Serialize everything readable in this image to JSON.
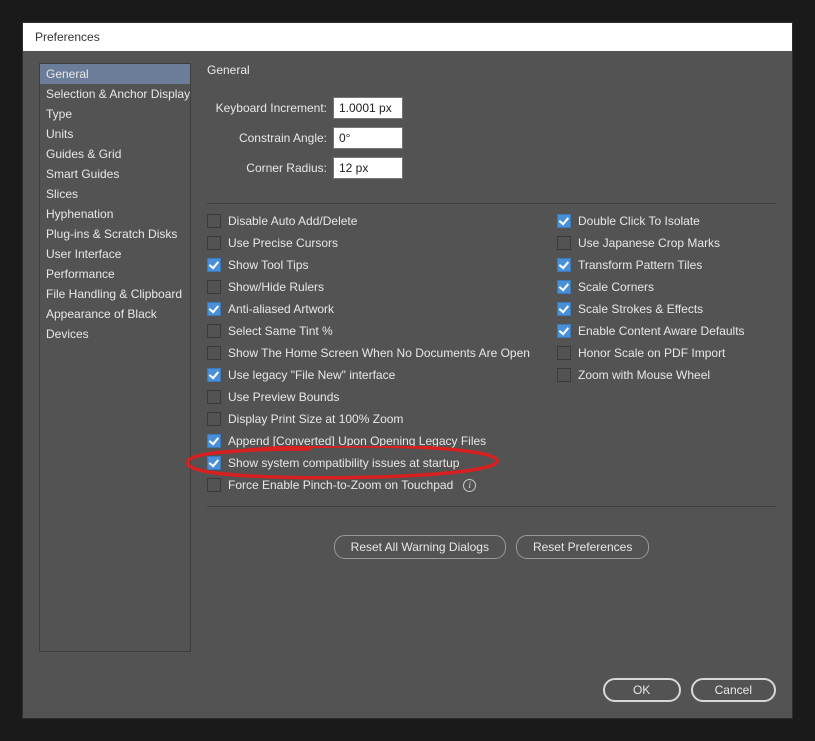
{
  "window": {
    "title": "Preferences"
  },
  "sidebar": {
    "items": [
      {
        "label": "General",
        "selected": true
      },
      {
        "label": "Selection & Anchor Display"
      },
      {
        "label": "Type"
      },
      {
        "label": "Units"
      },
      {
        "label": "Guides & Grid"
      },
      {
        "label": "Smart Guides"
      },
      {
        "label": "Slices"
      },
      {
        "label": "Hyphenation"
      },
      {
        "label": "Plug-ins & Scratch Disks"
      },
      {
        "label": "User Interface"
      },
      {
        "label": "Performance"
      },
      {
        "label": "File Handling & Clipboard"
      },
      {
        "label": "Appearance of Black"
      },
      {
        "label": "Devices"
      }
    ]
  },
  "panel": {
    "title": "General",
    "fields": {
      "keyboard_increment": {
        "label": "Keyboard Increment:",
        "value": "1.0001 px"
      },
      "constrain_angle": {
        "label": "Constrain Angle:",
        "value": "0°"
      },
      "corner_radius": {
        "label": "Corner Radius:",
        "value": "12 px"
      }
    },
    "checks_left": [
      {
        "label": "Disable Auto Add/Delete",
        "checked": false
      },
      {
        "label": "Use Precise Cursors",
        "checked": false
      },
      {
        "label": "Show Tool Tips",
        "checked": true
      },
      {
        "label": "Show/Hide Rulers",
        "checked": false
      },
      {
        "label": "Anti-aliased Artwork",
        "checked": true
      },
      {
        "label": "Select Same Tint %",
        "checked": false
      },
      {
        "label": "Show The Home Screen When No Documents Are Open",
        "checked": false
      },
      {
        "label": "Use legacy \"File New\" interface",
        "checked": true
      },
      {
        "label": "Use Preview Bounds",
        "checked": false
      },
      {
        "label": "Display Print Size at 100% Zoom",
        "checked": false
      },
      {
        "label": "Append [Converted] Upon Opening Legacy Files",
        "checked": true
      },
      {
        "label": "Show system compatibility issues at startup",
        "checked": true
      },
      {
        "label": "Force Enable Pinch-to-Zoom on Touchpad",
        "checked": false,
        "info": true
      }
    ],
    "checks_right": [
      {
        "label": "Double Click To Isolate",
        "checked": true
      },
      {
        "label": "Use Japanese Crop Marks",
        "checked": false
      },
      {
        "label": "Transform Pattern Tiles",
        "checked": true
      },
      {
        "label": "Scale Corners",
        "checked": true
      },
      {
        "label": "Scale Strokes & Effects",
        "checked": true
      },
      {
        "label": "Enable Content Aware Defaults",
        "checked": true
      },
      {
        "label": "Honor Scale on PDF Import",
        "checked": false
      },
      {
        "label": "Zoom with Mouse Wheel",
        "checked": false
      }
    ],
    "buttons": {
      "reset_warnings": "Reset All Warning Dialogs",
      "reset_prefs": "Reset Preferences"
    }
  },
  "footer": {
    "ok": "OK",
    "cancel": "Cancel"
  },
  "annotation": {
    "highlighted_index": 11
  }
}
